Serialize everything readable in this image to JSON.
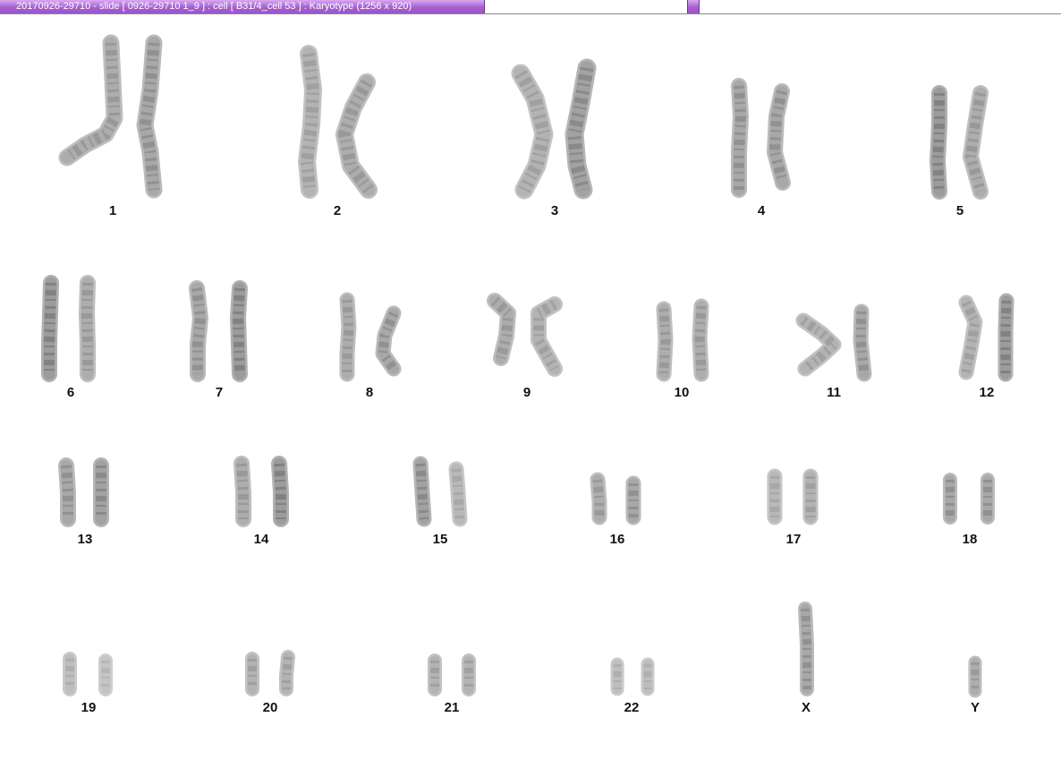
{
  "window": {
    "title": "20170926-29710 - slide [ 0926-29710 1_9 ] : cell [ B31/4_cell 53 ] : Karyotype  (1256 x 920)"
  },
  "karyotype": {
    "chromosomes": [
      {
        "id": "1",
        "label": "1"
      },
      {
        "id": "2",
        "label": "2"
      },
      {
        "id": "3",
        "label": "3"
      },
      {
        "id": "4",
        "label": "4"
      },
      {
        "id": "5",
        "label": "5"
      },
      {
        "id": "6",
        "label": "6"
      },
      {
        "id": "7",
        "label": "7"
      },
      {
        "id": "8",
        "label": "8"
      },
      {
        "id": "9",
        "label": "9"
      },
      {
        "id": "10",
        "label": "10"
      },
      {
        "id": "11",
        "label": "11"
      },
      {
        "id": "12",
        "label": "12"
      },
      {
        "id": "13",
        "label": "13"
      },
      {
        "id": "14",
        "label": "14"
      },
      {
        "id": "15",
        "label": "15"
      },
      {
        "id": "16",
        "label": "16"
      },
      {
        "id": "17",
        "label": "17"
      },
      {
        "id": "18",
        "label": "18"
      },
      {
        "id": "19",
        "label": "19"
      },
      {
        "id": "20",
        "label": "20"
      },
      {
        "id": "21",
        "label": "21"
      },
      {
        "id": "22",
        "label": "22"
      },
      {
        "id": "x",
        "label": "X"
      },
      {
        "id": "y",
        "label": "Y"
      }
    ]
  }
}
